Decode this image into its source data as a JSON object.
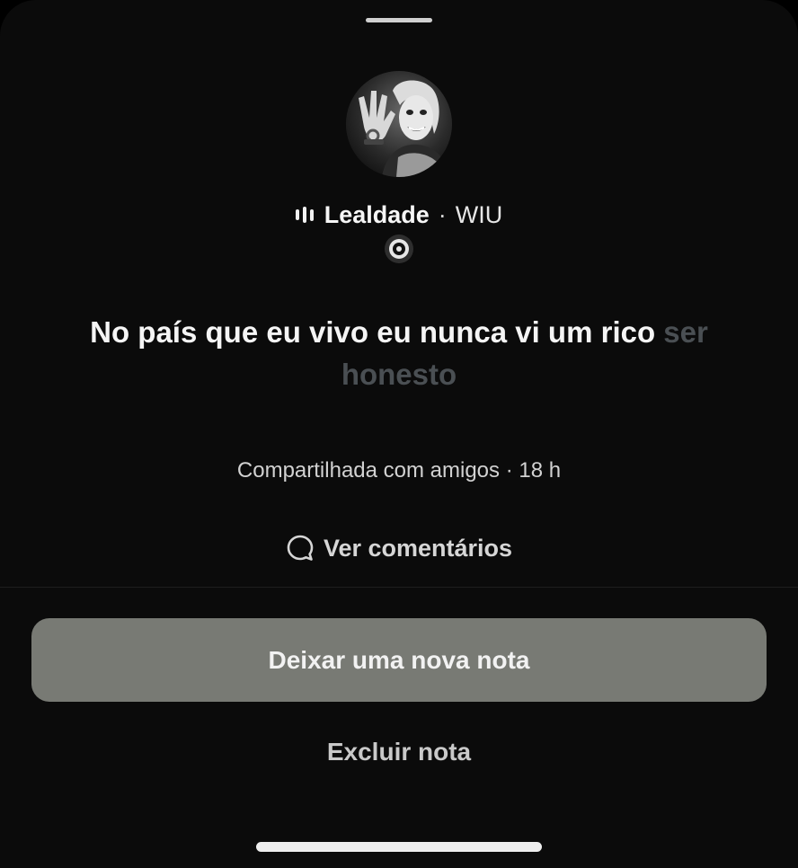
{
  "note": {
    "music": {
      "icon": "audio-bars-icon",
      "song": "Lealdade",
      "separator": "·",
      "artist": "WIU",
      "disc_icon": "vinyl-disc-icon"
    },
    "text_bright": "No país que eu vivo eu nunca vi um rico",
    "text_dim": "ser honesto",
    "meta": "Compartilhada com amigos · 18 h",
    "comments": {
      "icon": "comment-bubble-icon",
      "label": "Ver comentários"
    }
  },
  "actions": {
    "new_note": "Deixar uma nova nota",
    "delete_note": "Excluir nota"
  },
  "colors": {
    "background": "#0b0b0b",
    "primary_button": "#787a74",
    "dim_text": "#4a4f53"
  }
}
